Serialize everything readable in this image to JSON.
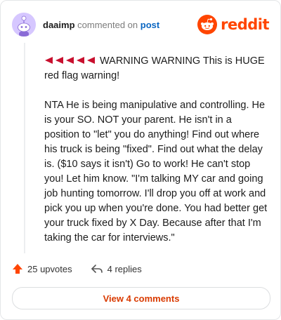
{
  "comment": {
    "username": "daaimp",
    "action": "commented on",
    "post_link": "post",
    "paragraphs": [
      "WARNING WARNING This is HUGE red flag warning!",
      "NTA He is being manipulative and controlling. He is your SO. NOT your parent. He isn't in a position to \"let\" you do anything! Find out where his truck is being \"fixed\". Find out what the delay is. ($10 says it isn't) Go to work! He can't stop you! Let him know. \"I'm talking MY car and going job hunting tomorrow. I'll drop you off at work and pick you up when you're done. You had better get your truck fixed by X Day. Because after that I'm taking the car for interviews.\""
    ],
    "flag_icon": "red-triangular-flag",
    "flag_count": 5
  },
  "brand": {
    "name": "reddit",
    "color": "#ff4500"
  },
  "footer": {
    "upvotes": "25 upvotes",
    "replies": "4 replies",
    "view_button": "View 4 comments"
  },
  "colors": {
    "accent": "#ff4500",
    "view_button_text": "#d93a00",
    "link": "#0a66c2"
  }
}
